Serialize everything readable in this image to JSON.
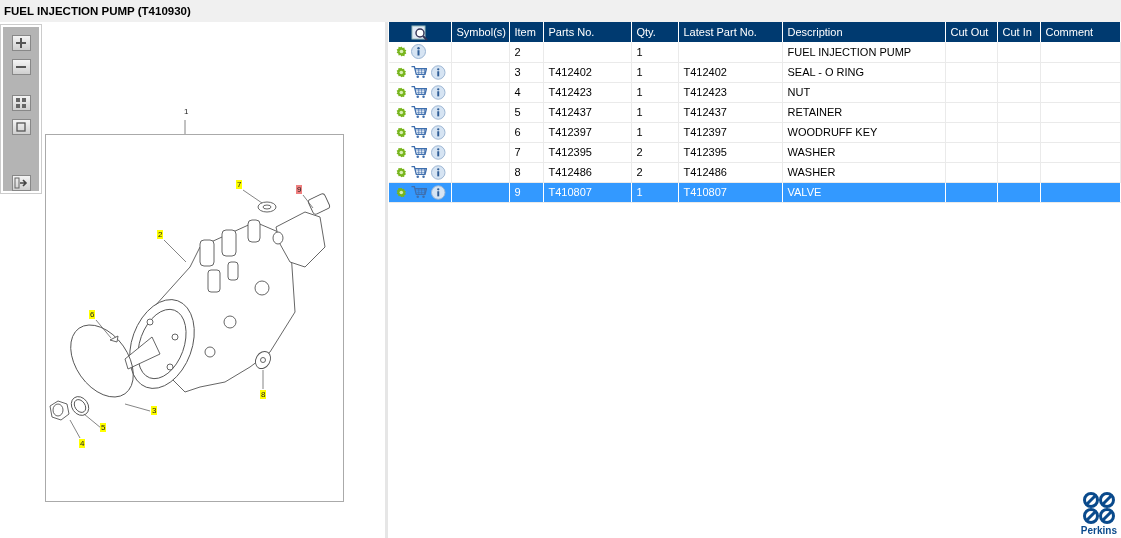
{
  "title": "FUEL INJECTION PUMP (T410930)",
  "diagram": {
    "callouts": [
      {
        "label": "1",
        "kind": "plain",
        "selected": false
      },
      {
        "label": "2",
        "kind": "tag",
        "selected": false
      },
      {
        "label": "3",
        "kind": "tag",
        "selected": false
      },
      {
        "label": "4",
        "kind": "tag",
        "selected": false
      },
      {
        "label": "5",
        "kind": "tag",
        "selected": false
      },
      {
        "label": "6",
        "kind": "tag",
        "selected": false
      },
      {
        "label": "7",
        "kind": "tag",
        "selected": false
      },
      {
        "label": "8",
        "kind": "tag",
        "selected": false
      },
      {
        "label": "9",
        "kind": "tag",
        "selected": true
      }
    ]
  },
  "table": {
    "columns": [
      "Symbol(s)",
      "Item",
      "Parts No.",
      "Qty.",
      "Latest Part No.",
      "Description",
      "Cut Out",
      "Cut In",
      "Comment"
    ],
    "rows": [
      {
        "orderable": false,
        "selected": false,
        "item": "2",
        "qty": "1",
        "description": "FUEL INJECTION PUMP"
      },
      {
        "orderable": true,
        "selected": false,
        "item": "3",
        "parts_no": "T412402",
        "qty": "1",
        "latest_part_no": "T412402",
        "description": "SEAL - O RING"
      },
      {
        "orderable": true,
        "selected": false,
        "item": "4",
        "parts_no": "T412423",
        "qty": "1",
        "latest_part_no": "T412423",
        "description": "NUT"
      },
      {
        "orderable": true,
        "selected": false,
        "item": "5",
        "parts_no": "T412437",
        "qty": "1",
        "latest_part_no": "T412437",
        "description": "RETAINER"
      },
      {
        "orderable": true,
        "selected": false,
        "item": "6",
        "parts_no": "T412397",
        "qty": "1",
        "latest_part_no": "T412397",
        "description": "WOODRUFF KEY"
      },
      {
        "orderable": true,
        "selected": false,
        "item": "7",
        "parts_no": "T412395",
        "qty": "2",
        "latest_part_no": "T412395",
        "description": "WASHER"
      },
      {
        "orderable": true,
        "selected": false,
        "item": "8",
        "parts_no": "T412486",
        "qty": "2",
        "latest_part_no": "T412486",
        "description": "WASHER"
      },
      {
        "orderable": true,
        "selected": true,
        "item": "9",
        "parts_no": "T410807",
        "qty": "1",
        "latest_part_no": "T410807",
        "description": "VALVE"
      }
    ]
  },
  "brand": "Perkins"
}
